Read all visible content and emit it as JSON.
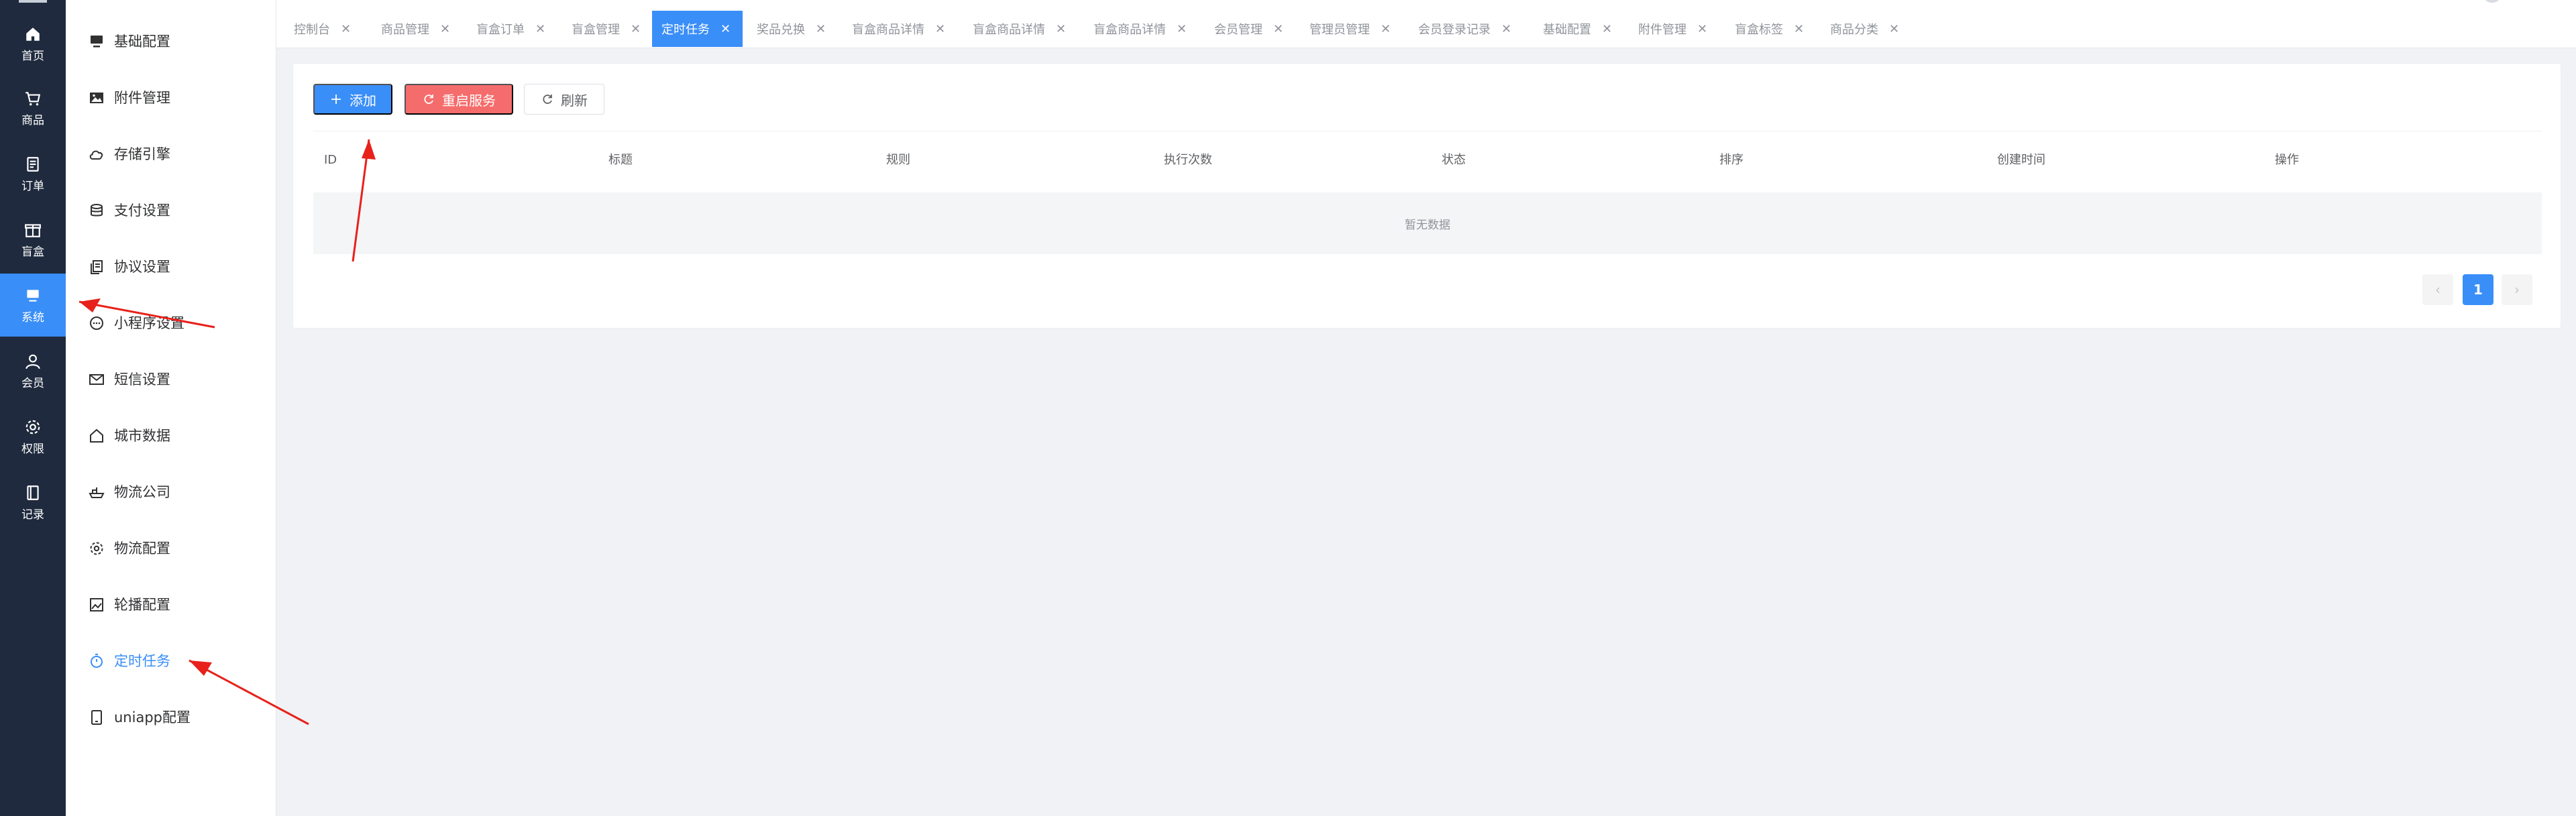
{
  "rail": {
    "items": [
      {
        "label": "首页",
        "icon": "home-icon"
      },
      {
        "label": "商品",
        "icon": "cart-icon"
      },
      {
        "label": "订单",
        "icon": "order-icon"
      },
      {
        "label": "盲盒",
        "icon": "box-icon"
      },
      {
        "label": "系统",
        "icon": "system-icon"
      },
      {
        "label": "会员",
        "icon": "user-icon"
      },
      {
        "label": "权限",
        "icon": "gear-icon"
      },
      {
        "label": "记录",
        "icon": "record-icon"
      }
    ]
  },
  "submenu": {
    "items": [
      {
        "label": "基础配置",
        "icon": "monitor-icon"
      },
      {
        "label": "附件管理",
        "icon": "image-icon"
      },
      {
        "label": "存储引擎",
        "icon": "cloud-icon"
      },
      {
        "label": "支付设置",
        "icon": "coins-icon"
      },
      {
        "label": "协议设置",
        "icon": "document-icon"
      },
      {
        "label": "小程序设置",
        "icon": "chat-icon"
      },
      {
        "label": "短信设置",
        "icon": "message-icon"
      },
      {
        "label": "城市数据",
        "icon": "house-icon"
      },
      {
        "label": "物流公司",
        "icon": "ship-icon"
      },
      {
        "label": "物流配置",
        "icon": "settings-icon"
      },
      {
        "label": "轮播配置",
        "icon": "picture-icon"
      },
      {
        "label": "定时任务",
        "icon": "timer-icon"
      },
      {
        "label": "uniapp配置",
        "icon": "tablet-icon"
      }
    ]
  },
  "tabs": [
    {
      "label": "控制台"
    },
    {
      "label": "商品管理"
    },
    {
      "label": "盲盒订单"
    },
    {
      "label": "盲盒管理"
    },
    {
      "label": "定时任务"
    },
    {
      "label": "奖品兑换"
    },
    {
      "label": "盲盒商品详情"
    },
    {
      "label": "盲盒商品详情"
    },
    {
      "label": "盲盒商品详情"
    },
    {
      "label": "会员管理"
    },
    {
      "label": "管理员管理"
    },
    {
      "label": "会员登录记录"
    },
    {
      "label": "基础配置"
    },
    {
      "label": "附件管理"
    },
    {
      "label": "盲盒标签"
    },
    {
      "label": "商品分类"
    }
  ],
  "tab_close_glyph": "✕",
  "toolbar": {
    "add_label": "添加",
    "restart_label": "重启服务",
    "refresh_label": "刷新"
  },
  "table": {
    "columns": [
      "ID",
      "标题",
      "规则",
      "执行次数",
      "状态",
      "排序",
      "创建时间",
      "操作"
    ],
    "empty_text": "暂无数据"
  },
  "pagination": {
    "prev": "‹",
    "current": "1",
    "next": "›"
  },
  "colors": {
    "primary": "#3a8ef8",
    "danger": "#f56c6c",
    "rail_bg": "#1f2a3e",
    "annotation": "#e8211b"
  }
}
